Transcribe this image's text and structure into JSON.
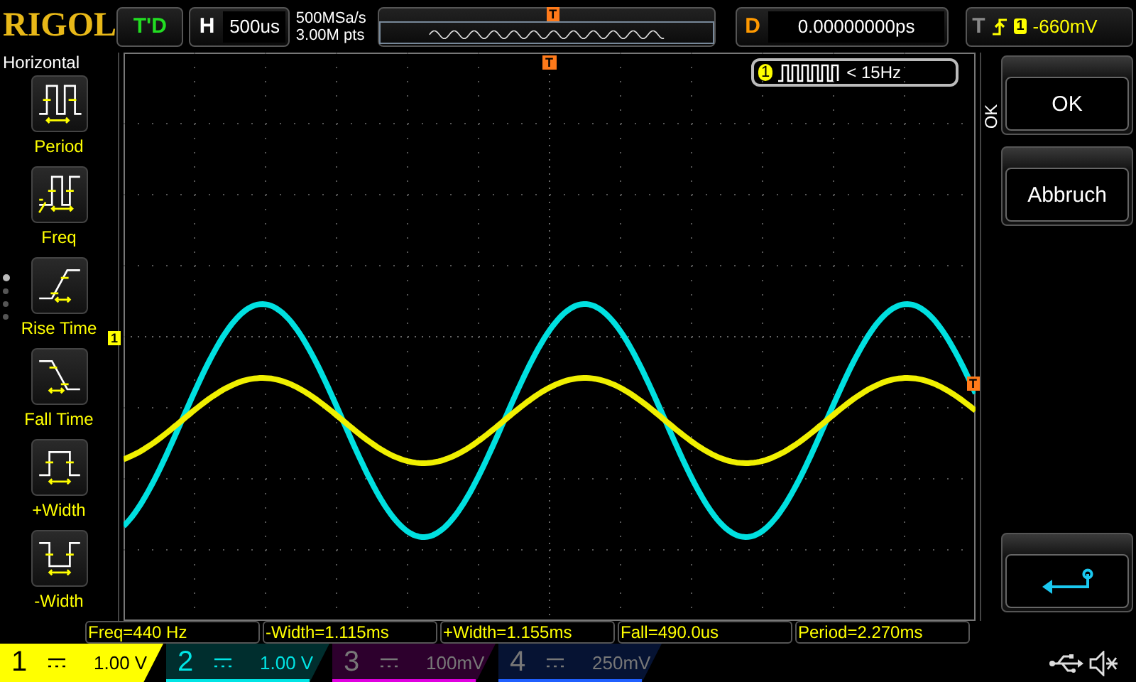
{
  "top_bar": {
    "logo": "RIGOL",
    "run_status": "T'D",
    "timebase": {
      "label": "H",
      "value": "500us"
    },
    "sample_rate": "500MSa/s",
    "memory_depth": "3.00M pts",
    "memory_marker": "T",
    "delay": {
      "label": "D",
      "value": "0.00000000ps"
    },
    "trigger": {
      "label": "T",
      "channel": "1",
      "level": "-660mV"
    }
  },
  "menu": {
    "title": "Horizontal",
    "items": [
      {
        "label": "Period",
        "kind": "period"
      },
      {
        "label": "Freq",
        "kind": "freq"
      },
      {
        "label": "Rise Time",
        "kind": "rise"
      },
      {
        "label": "Fall Time",
        "kind": "fall"
      },
      {
        "label": "+Width",
        "kind": "pwidth"
      },
      {
        "label": "-Width",
        "kind": "nwidth"
      }
    ],
    "pages": [
      {
        "selected": true
      },
      {
        "selected": false
      },
      {
        "selected": false
      },
      {
        "selected": false
      }
    ]
  },
  "screen": {
    "trigger_position_marker": "T",
    "trigger_level_marker": "T",
    "channel_marker": "1",
    "counter": {
      "channel": "1",
      "reading": "< 15Hz"
    }
  },
  "side_panel": {
    "title": "OK",
    "buttons": [
      "OK",
      "Abbruch"
    ]
  },
  "measurements": [
    "Freq=440 Hz",
    "-Width=1.115ms",
    "+Width=1.155ms",
    "Fall=490.0us",
    "Period=2.270ms"
  ],
  "channels": [
    {
      "number": "1",
      "scale": "1.00 V",
      "on": true,
      "selected": true,
      "color": "#ffff00"
    },
    {
      "number": "2",
      "scale": "1.00 V",
      "on": true,
      "selected": false,
      "color": "#00e5e5"
    },
    {
      "number": "3",
      "scale": "100mV",
      "on": false,
      "selected": false,
      "color": "#e000e0"
    },
    {
      "number": "4",
      "scale": "250mV",
      "on": false,
      "selected": false,
      "color": "#2060ff"
    }
  ]
}
